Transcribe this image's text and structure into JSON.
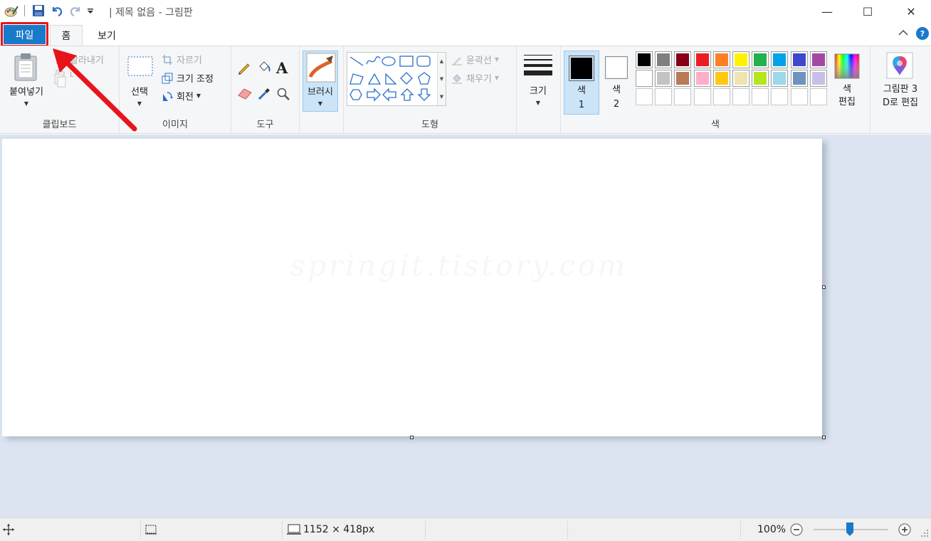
{
  "window": {
    "title": "| 제목 없음 - 그림판",
    "minimize_glyph": "—",
    "maximize_glyph": "☐",
    "close_glyph": "✕"
  },
  "tabs": [
    {
      "label": "파일"
    },
    {
      "label": "홈"
    },
    {
      "label": "보기"
    }
  ],
  "ribbon": {
    "clipboard": {
      "paste_label": "붙여넣기",
      "cut_label": "잘라내기",
      "copy_hint": "L",
      "group_label": "클립보드"
    },
    "image": {
      "select_label": "선택",
      "crop_label": "자르기",
      "resize_label": "크기 조정",
      "rotate_label": "회전",
      "group_label": "이미지"
    },
    "tools": {
      "text_glyph": "A",
      "group_label": "도구"
    },
    "brush": {
      "label": "브러시"
    },
    "shapes": {
      "outline_label": "윤곽선",
      "fill_label": "채우기",
      "group_label": "도형"
    },
    "size": {
      "label": "크기"
    },
    "colors": {
      "color1_label": "색",
      "color1_num": "1",
      "color2_label": "색",
      "color2_num": "2",
      "edit_label_1": "색",
      "edit_label_2": "편집",
      "group_label": "색",
      "color1_value": "#000000",
      "color2_value": "#ffffff",
      "palette_row1": [
        "#000000",
        "#7f7f7f",
        "#880015",
        "#ed1c24",
        "#ff7f27",
        "#fff200",
        "#22b14c",
        "#00a2e8",
        "#3f48cc",
        "#a349a4"
      ],
      "palette_row2": [
        "#ffffff",
        "#c3c3c3",
        "#b97a57",
        "#ffaec9",
        "#ffc90e",
        "#efe4b0",
        "#b5e61d",
        "#99d9ea",
        "#7092be",
        "#c8bfe7"
      ]
    },
    "paint3d": {
      "label_1": "그림판 3",
      "label_2": "D로 편집"
    }
  },
  "canvas": {
    "watermark": "springit.tistory.com"
  },
  "statusbar": {
    "dimensions": "1152 × 418px",
    "zoom": "100%",
    "zoom_level_percent": 100
  },
  "annotation": {
    "highlight_color": "#e8141b",
    "target": "tab-file"
  }
}
